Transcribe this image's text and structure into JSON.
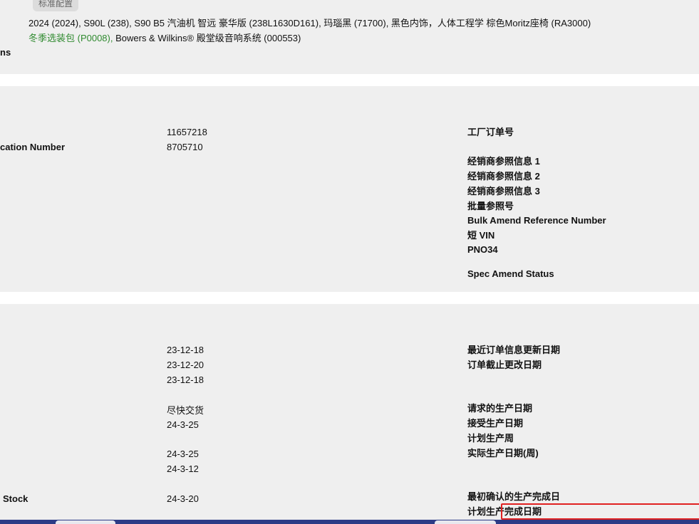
{
  "spec": {
    "tag": "标准配置",
    "line1": "2024 (2024), S90L (238), S90 B5 汽油机 智远 豪华版 (238L1630D161), 玛瑙黑 (71700), 黑色内饰，人体工程学 棕色Moritz座椅 (RA3000)",
    "line2_green": "冬季选装包 (P0008),",
    "line2_rest": " Bowers & Wilkins® 殿堂级音响系统 (000553)",
    "section_label_cut": "ns"
  },
  "ids": {
    "left_label_cut": "cation Number",
    "values": [
      "11657218",
      "8705710"
    ],
    "right_labels": [
      "工厂订单号",
      "经销商参照信息 1",
      "经销商参照信息 2",
      "经销商参照信息 3",
      "批量参照号",
      "Bulk Amend Reference Number",
      "短 VIN",
      "PNO34",
      "Spec Amend Status"
    ]
  },
  "dates": {
    "left_label_cut": "Stock",
    "values": [
      "23-12-18",
      "23-12-20",
      "23-12-18",
      "尽快交货",
      "24-3-25",
      "24-3-25",
      "24-3-12",
      "24-3-20"
    ],
    "right_labels": [
      "最近订单信息更新日期",
      "订单截止更改日期",
      "请求的生产日期",
      "接受生产日期",
      "计划生产周",
      "实际生产日期(周)",
      "最初确认的生产完成日",
      "计划生产完成日期"
    ]
  },
  "colors": {
    "panel_bg": "#efefef",
    "accent_green": "#2f8a2f",
    "highlight_red": "#e02020",
    "taskbar": "#2c3b86"
  }
}
